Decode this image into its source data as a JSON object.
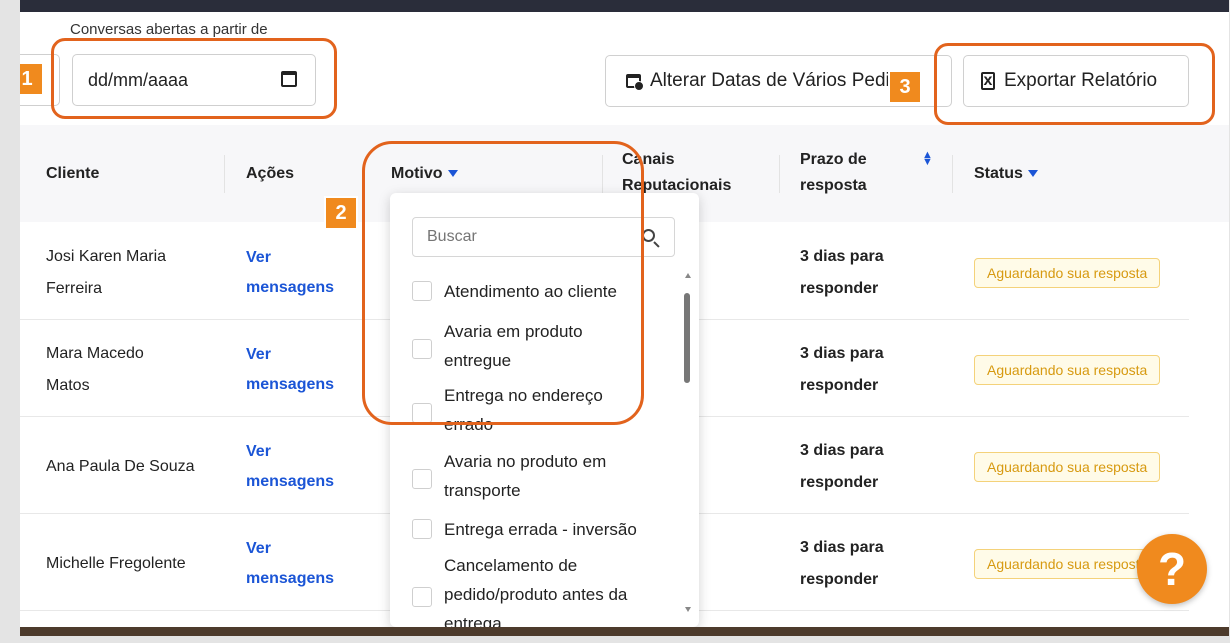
{
  "filters": {
    "date_label": "Conversas abertas a partir de",
    "date_placeholder": "dd/mm/aaaa",
    "alterar_label": "Alterar Datas de Vários Pedidos",
    "exportar_label": "Exportar Relatório"
  },
  "table": {
    "headers": {
      "cliente": "Cliente",
      "acoes": "Ações",
      "motivo": "Motivo",
      "canais": "Canais Reputacionais",
      "prazo": "Prazo de resposta",
      "status": "Status"
    },
    "rows": [
      {
        "client": "Josi Karen Maria Ferreira",
        "action": "Ver mensagens",
        "prazo": "3 dias para responder",
        "status": "Aguardando sua resposta"
      },
      {
        "client": "Mara Macedo Matos",
        "action": "Ver mensagens",
        "prazo": "3 dias para responder",
        "status": "Aguardando sua resposta"
      },
      {
        "client": "Ana Paula De Souza",
        "action": "Ver mensagens",
        "prazo": "3 dias para responder",
        "status": "Aguardando sua resposta"
      },
      {
        "client": "Michelle Fregolente",
        "action": "Ver mensagens",
        "prazo": "3 dias para responder",
        "status": "Aguardando sua resposta"
      }
    ]
  },
  "dropdown": {
    "search_placeholder": "Buscar",
    "options": [
      "Atendimento ao cliente",
      "Avaria em produto entregue",
      "Entrega no endereço errado",
      "Avaria no produto em transporte",
      "Entrega errada - inversão",
      "Cancelamento de pedido/produto antes da entrega"
    ]
  },
  "annotations": {
    "one": "1",
    "two": "2",
    "three": "3"
  },
  "help": {
    "label": "?"
  },
  "colors": {
    "accent": "#1b55d6",
    "annotation": "#e2631d",
    "badge": "#d79a11"
  }
}
